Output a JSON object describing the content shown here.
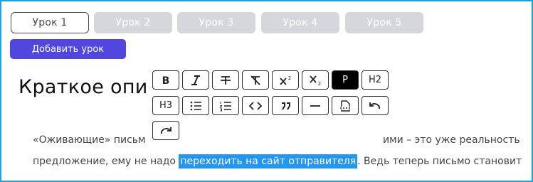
{
  "tabs": [
    {
      "label": "Урок 1"
    },
    {
      "label": "Урок 2"
    },
    {
      "label": "Урок 3"
    },
    {
      "label": "Урок 4"
    },
    {
      "label": "Урок 5"
    }
  ],
  "add_button": {
    "label": "Добавить урок"
  },
  "heading": {
    "text": "Краткое опис"
  },
  "paragraph": {
    "line1_start": "«Оживающие» письм",
    "line1_end": "ими – это уже реальность",
    "line2_before": "предложение, ему не надо ",
    "line2_selected": "переходить на сайт отправителя",
    "line2_after": ". Ведь теперь письмо становит"
  },
  "toolbar": {
    "p_label": "P",
    "h2_label": "H2",
    "h3_label": "H3"
  },
  "colors": {
    "accent": "#5146dd",
    "selection": "#2196f3",
    "frame": "#1ea3d8"
  }
}
